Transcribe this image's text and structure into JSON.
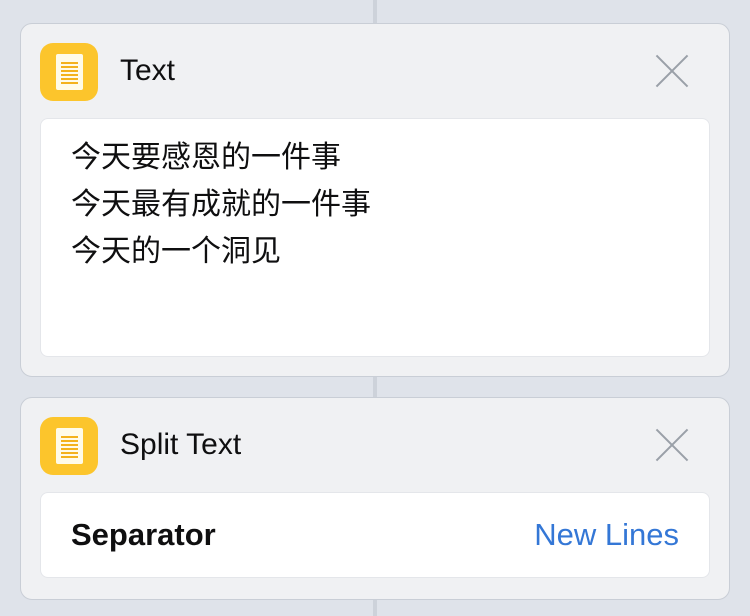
{
  "actions": [
    {
      "title": "Text",
      "icon": "text-document-icon",
      "content": "今天要感恩的一件事\n今天最有成就的一件事\n今天的一个洞见"
    },
    {
      "title": "Split Text",
      "icon": "text-document-icon",
      "parameter": {
        "label": "Separator",
        "value": "New Lines"
      }
    }
  ],
  "colors": {
    "background": "#dfe3ea",
    "icon": "#fcc52c",
    "accent": "#3477d6"
  }
}
